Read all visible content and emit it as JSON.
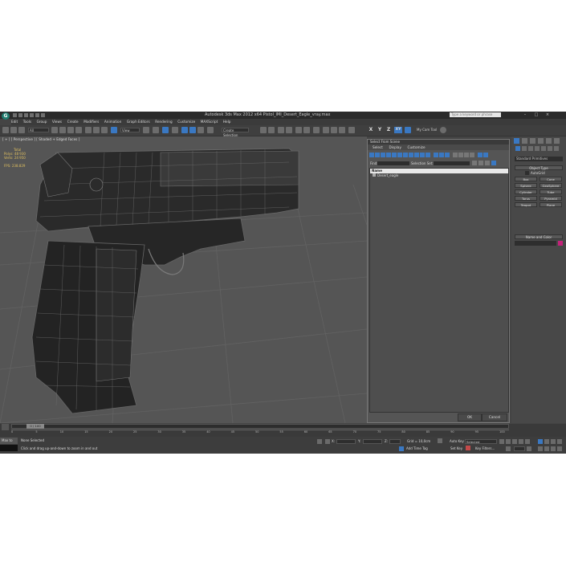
{
  "window": {
    "title": "Autodesk 3ds Max  2012 x64    Pistol_IMI_Desert_Eagle_vray.max",
    "search_placeholder": "Type a keyword or phrase",
    "logo": "max-logo"
  },
  "menu": [
    "Edit",
    "Tools",
    "Group",
    "Views",
    "Create",
    "Modifiers",
    "Animation",
    "Graph Editors",
    "Rendering",
    "Customize",
    "MAXScript",
    "Help"
  ],
  "toolbar": {
    "filter_dropdown": "All",
    "view_dropdown": "View",
    "named_selection": "Create Selection",
    "axis_letters": [
      "X",
      "Y",
      "Z",
      "XY"
    ],
    "my_cam_tool": "My Cam Tool"
  },
  "viewport": {
    "label": "[ + ] [ Perspective ] [ Shaded + Edged Faces ]",
    "stats": {
      "header": "Total",
      "polys_label": "Polys:",
      "polys_value": "48 930",
      "verts_label": "Verts:",
      "verts_value": "24 950",
      "fps_label": "FPS:",
      "fps_value": "238.829"
    },
    "model": "pistol-wireframe",
    "grid_color": "#606060",
    "bg_color": "#555555"
  },
  "scene_explorer": {
    "title": "Select From Scene",
    "menu": [
      "Select",
      "Display",
      "Customize"
    ],
    "find_label": "Find:",
    "selection_set_label": "Selection Set:",
    "column_header": "Name",
    "items": [
      "Desert_eagle"
    ],
    "ok_label": "OK",
    "cancel_label": "Cancel"
  },
  "command_panel": {
    "dropdown": "Standard Primitives",
    "object_type_title": "Object Type",
    "autogrid_label": "AutoGrid",
    "buttons": [
      "Box",
      "Cone",
      "Sphere",
      "GeoSphere",
      "Cylinder",
      "Tube",
      "Torus",
      "Pyramid",
      "Teapot",
      "Plane"
    ],
    "name_color_title": "Name and Color",
    "object_color": "#c4217a"
  },
  "timeline": {
    "slider_label": "0 / 100",
    "ticks": [
      "0",
      "5",
      "10",
      "15",
      "20",
      "25",
      "30",
      "35",
      "40",
      "45",
      "50",
      "55",
      "60",
      "65",
      "70",
      "75",
      "80",
      "85",
      "90",
      "95",
      "100"
    ]
  },
  "status": {
    "script_label": "Max to",
    "selection_status": "None Selected",
    "prompt": "Click and drag up-and-down to zoom in and out",
    "x_label": "X:",
    "y_label": "Y:",
    "z_label": "Z:",
    "grid_label": "Grid = 10,0cm",
    "auto_key": "Auto Key",
    "selected_dropdown": "Selected",
    "set_key": "Set Key",
    "key_filters": "Key Filters...",
    "add_time_tag": "Add Time Tag"
  }
}
